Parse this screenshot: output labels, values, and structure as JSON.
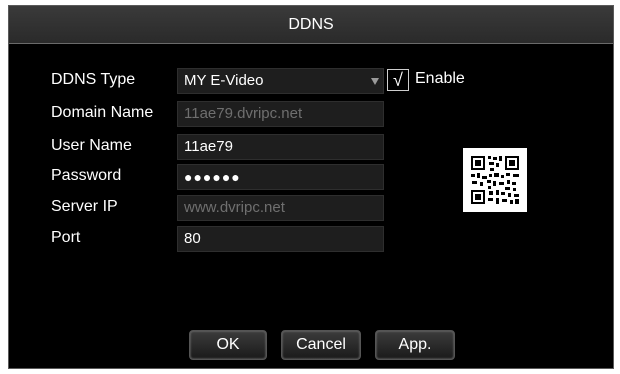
{
  "dialog": {
    "title": "DDNS"
  },
  "form": {
    "ddns_type": {
      "label": "DDNS Type",
      "value": "MY E-Video"
    },
    "enable": {
      "label": "Enable",
      "checked": true,
      "mark": "√"
    },
    "domain_name": {
      "label": "Domain Name",
      "value": "11ae79.dvripc.net",
      "disabled": true
    },
    "user_name": {
      "label": "User Name",
      "value": "11ae79"
    },
    "password": {
      "label": "Password",
      "value": "●●●●●●"
    },
    "server_ip": {
      "label": "Server IP",
      "value": "www.dvripc.net",
      "disabled": true
    },
    "port": {
      "label": "Port",
      "value": "80"
    }
  },
  "qr": {
    "icon": "qr-code-icon"
  },
  "buttons": {
    "ok": "OK",
    "cancel": "Cancel",
    "apply": "App."
  },
  "colors": {
    "background": "#000000",
    "field": "#1e1e1e",
    "disabled_text": "#6f6f6f"
  }
}
